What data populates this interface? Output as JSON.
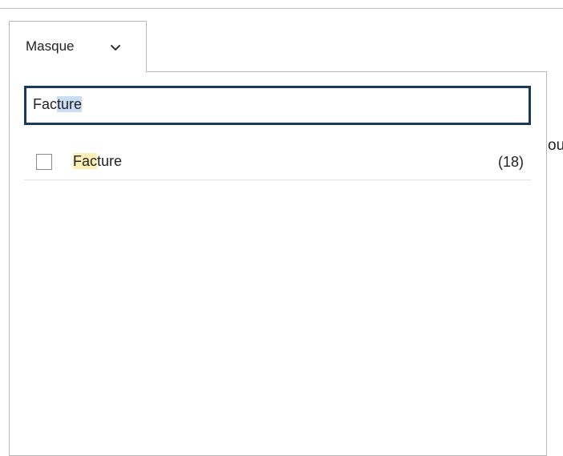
{
  "background": {
    "fragment_text": "ou"
  },
  "filter_tab": {
    "label": "Masque",
    "chevron_icon": "chevron-down-icon"
  },
  "search": {
    "value": "Facture",
    "value_before_caret": "Fac",
    "value_after_caret": "ture"
  },
  "results": [
    {
      "label": "Facture",
      "label_match": "Fac",
      "label_rest": "ture",
      "count": "(18)",
      "checked": false
    }
  ],
  "colors": {
    "focus_border": "#1a3a5c",
    "selection": "#c9def5",
    "match_highlight": "#fdeeb5",
    "border": "#b8b8b8"
  }
}
